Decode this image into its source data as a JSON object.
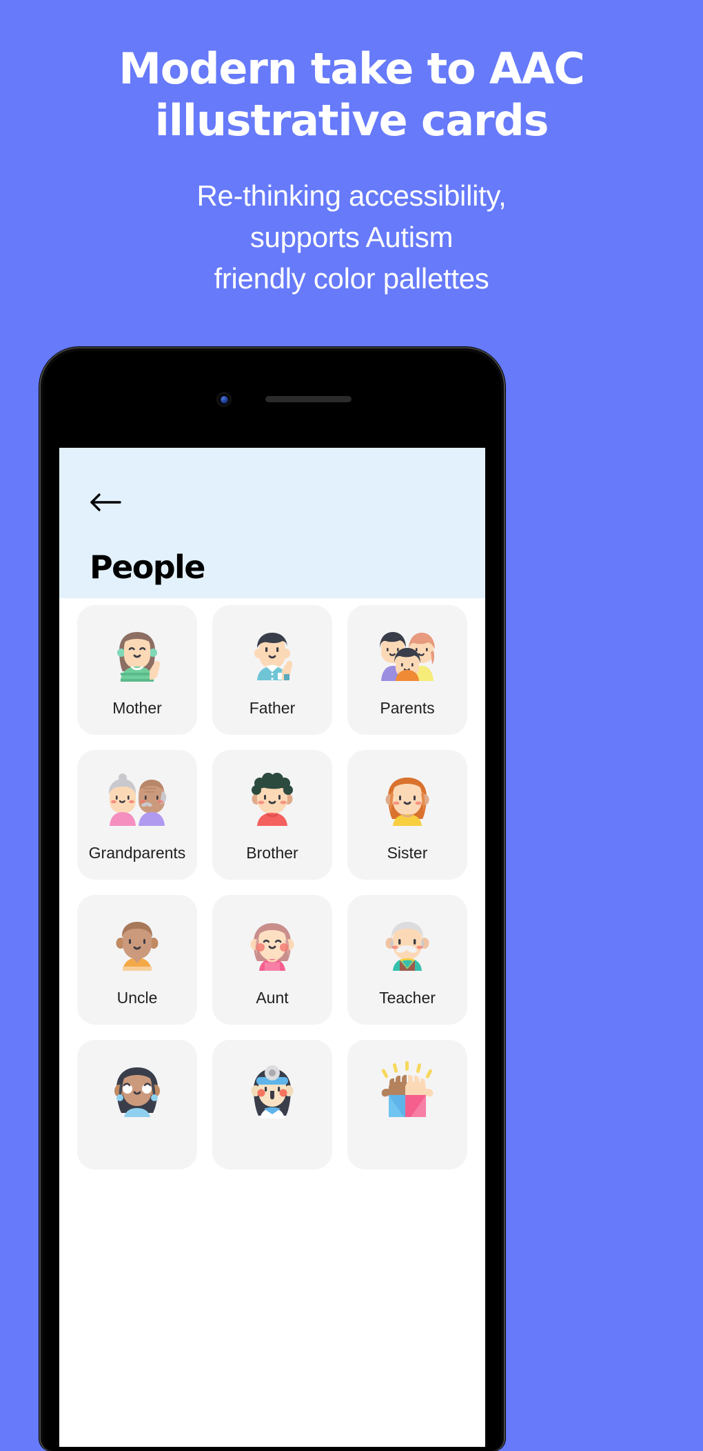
{
  "hero": {
    "title_line1": "Modern take to AAC",
    "title_line2": "illustrative cards",
    "sub_line1": "Re-thinking accessibility,",
    "sub_line2": "supports Autism",
    "sub_line3": "friendly color pallettes"
  },
  "colors": {
    "background": "#667afa",
    "hero_text": "#ffffff",
    "app_header": "#e3f1fc",
    "screen_bg": "#ffffff",
    "card_bg": "#f4f4f5",
    "card_label": "#1f1f1f",
    "phone_frame": "#0a0a0a"
  },
  "phone": {
    "camera": "front-camera",
    "speaker": "earpiece-speaker"
  },
  "app": {
    "back_label": "Back",
    "title": "People",
    "cards": [
      {
        "label": "Mother",
        "art": "woman-waving-green-top"
      },
      {
        "label": "Father",
        "art": "man-waving-blue-shirt"
      },
      {
        "label": "Parents",
        "art": "family-three-people"
      },
      {
        "label": "Grandparents",
        "art": "elderly-couple"
      },
      {
        "label": "Brother",
        "art": "boy-curly-hair-red-shirt"
      },
      {
        "label": "Sister",
        "art": "girl-ginger-hair-yellow-top"
      },
      {
        "label": "Uncle",
        "art": "man-orange-shirt"
      },
      {
        "label": "Aunt",
        "art": "woman-pink-dress"
      },
      {
        "label": "Teacher",
        "art": "elderly-man-vest"
      },
      {
        "label": "",
        "art": "woman-dark-curly-hair"
      },
      {
        "label": "",
        "art": "doctor-head-mirror"
      },
      {
        "label": "",
        "art": "high-five-hands"
      }
    ]
  }
}
